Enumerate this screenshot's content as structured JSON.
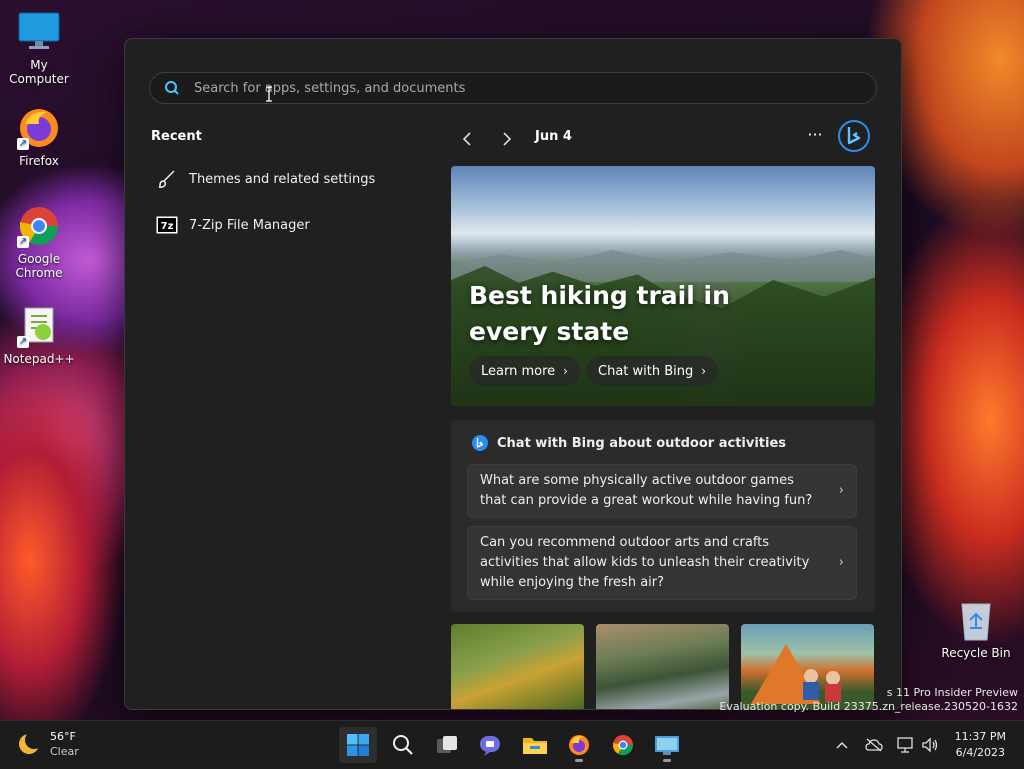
{
  "desktop": {
    "icons": [
      {
        "label": "My Computer"
      },
      {
        "label": "Firefox"
      },
      {
        "label": "Google Chrome"
      },
      {
        "label": "Notepad++"
      }
    ],
    "recycle_bin": "Recycle Bin"
  },
  "start_menu": {
    "search": {
      "placeholder": "Search for apps, settings, and documents"
    },
    "recent": {
      "title": "Recent",
      "items": [
        {
          "label": "Themes and related settings",
          "icon": "paintbrush-icon"
        },
        {
          "label": "7-Zip File Manager",
          "icon": "7zip-icon"
        }
      ]
    },
    "feed": {
      "date": "Jun 4",
      "more": "···",
      "hero": {
        "title": "Best hiking trail in every state",
        "learn_more": "Learn more",
        "chat_with_bing": "Chat with Bing"
      },
      "chat_card": {
        "title": "Chat with Bing about outdoor activities",
        "questions": [
          "What are some physically active outdoor games that can provide a great workout while having fun?",
          "Can you recommend outdoor arts and crafts activities that allow kids to unleash their creativity while enjoying the fresh air?"
        ]
      }
    }
  },
  "watermark": {
    "line1": "s 11 Pro Insider Preview",
    "line2": "Evaluation copy. Build 23375.zn_release.230520-1632"
  },
  "taskbar": {
    "weather": {
      "temp": "56°F",
      "condition": "Clear"
    },
    "clock": {
      "time": "11:37 PM",
      "date": "6/4/2023"
    }
  },
  "colors": {
    "panel_bg": "#202020",
    "card_bg": "#2b2b2b",
    "accent": "#4cc2ff",
    "taskbar_bg": "#1c1c1c"
  }
}
